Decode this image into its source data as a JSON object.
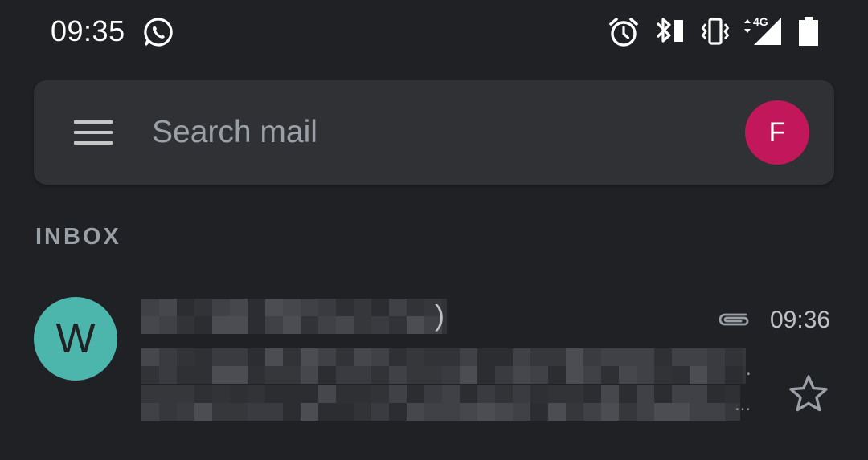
{
  "status_bar": {
    "time": "09:35",
    "signal_label": "4G",
    "icons": [
      "whatsapp-icon",
      "alarm-icon",
      "bluetooth-battery-icon",
      "vibrate-icon",
      "signal-4g-icon",
      "battery-icon"
    ]
  },
  "search": {
    "placeholder": "Search mail",
    "menu_icon": "menu-icon",
    "account_initial": "F",
    "account_color": "#c2185b"
  },
  "section": {
    "label": "INBOX"
  },
  "emails": [
    {
      "avatar_initial": "W",
      "avatar_color": "#4db6ac",
      "sender_visible_fragment": ")",
      "time": "09:36",
      "has_attachment": true,
      "starred": false,
      "content_pixelated": true
    }
  ],
  "colors": {
    "background": "#202124",
    "search_bar": "#303134",
    "muted_text": "#9aa0a6"
  }
}
